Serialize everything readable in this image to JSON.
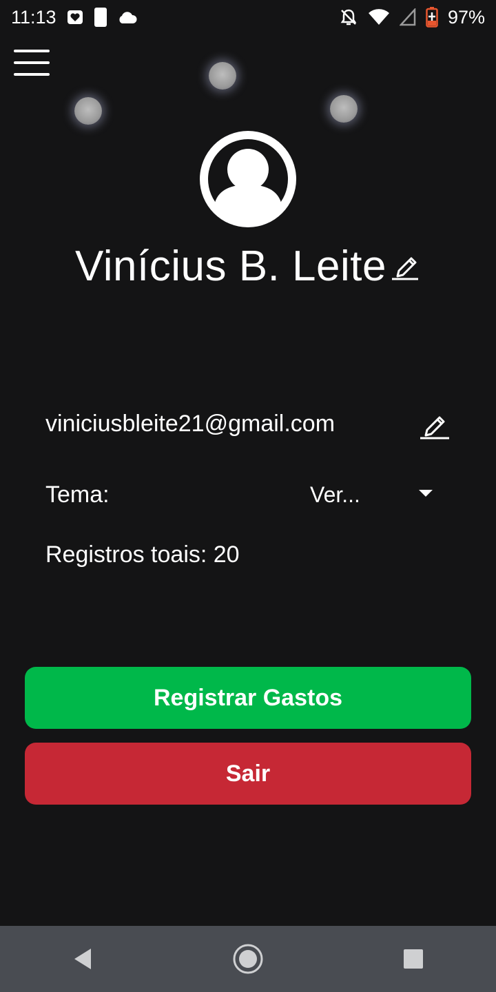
{
  "status_bar": {
    "time": "11:13",
    "battery_percent": "97%",
    "icons": [
      "heart-notification-icon",
      "moon-phone-icon",
      "cloud-icon",
      "bell-off-icon",
      "wifi-icon",
      "signal-icon",
      "battery-charging-icon"
    ],
    "battery_color": "#e8562f"
  },
  "header": {
    "menu_icon": "hamburger-menu-icon"
  },
  "profile": {
    "avatar_icon": "user-avatar-icon",
    "name": "Vinícius B. Leite",
    "email": "viniciusbleite21@gmail.com"
  },
  "settings": {
    "theme_label": "Tema:",
    "theme_value": "Ver...",
    "records_text": "Registros toais: 20"
  },
  "actions": {
    "register_label": "Registrar Gastos",
    "logout_label": "Sair"
  },
  "colors": {
    "background": "#141415",
    "register_button": "#00b84a",
    "logout_button": "#c62835",
    "nav_bar": "#494c52"
  },
  "nav": {
    "back_icon": "back-triangle-icon",
    "home_icon": "home-circle-icon",
    "recents_icon": "recents-square-icon"
  }
}
